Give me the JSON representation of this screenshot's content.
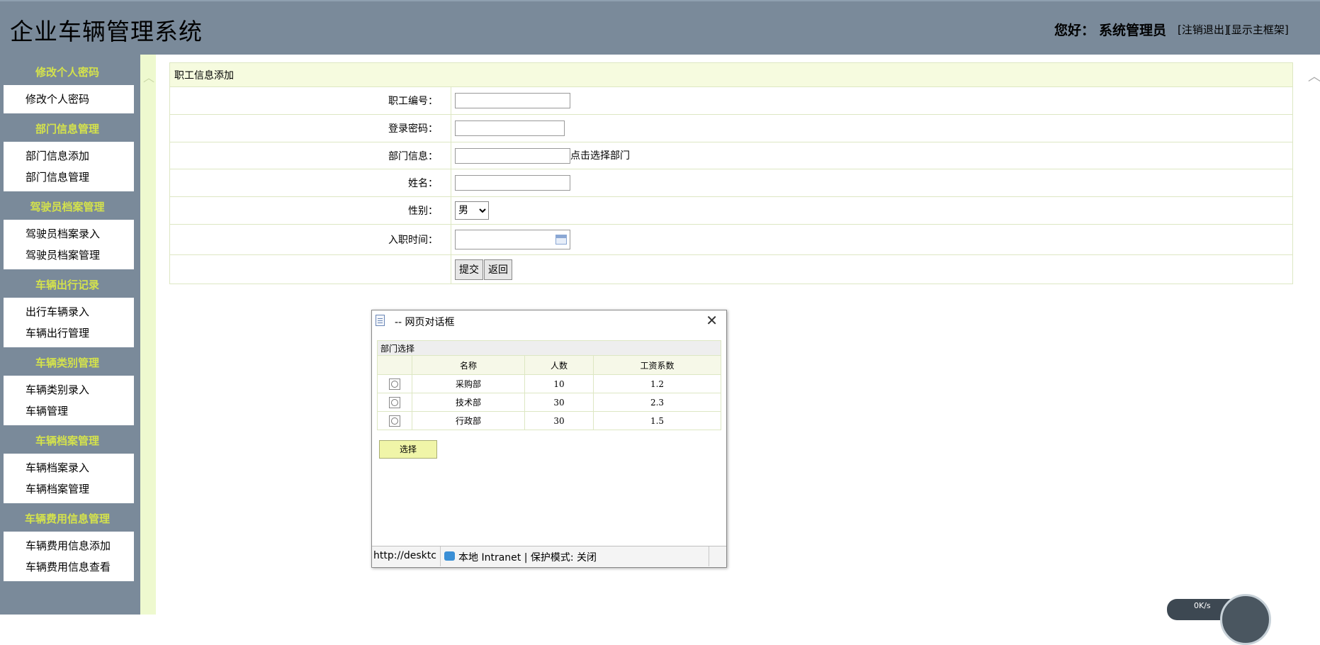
{
  "header": {
    "title": "企业车辆管理系统",
    "greeting_prefix": "您好：",
    "user_name": "系统管理员",
    "logout_label": "[注销退出]",
    "show_frame_label": "[显示主框架]"
  },
  "sidebar": {
    "groups": [
      {
        "title": "修改个人密码",
        "items": [
          "修改个人密码"
        ]
      },
      {
        "title": "部门信息管理",
        "items": [
          "部门信息添加",
          "部门信息管理"
        ]
      },
      {
        "title": "驾驶员档案管理",
        "items": [
          "驾驶员档案录入",
          "驾驶员档案管理"
        ]
      },
      {
        "title": "车辆出行记录",
        "items": [
          "出行车辆录入",
          "车辆出行管理"
        ]
      },
      {
        "title": "车辆类别管理",
        "items": [
          "车辆类别录入",
          "车辆管理"
        ]
      },
      {
        "title": "车辆档案管理",
        "items": [
          "车辆档案录入",
          "车辆档案管理"
        ]
      },
      {
        "title": "车辆费用信息管理",
        "items": [
          "车辆费用信息添加",
          "车辆费用信息查看"
        ]
      }
    ]
  },
  "form": {
    "title": "职工信息添加",
    "fields": {
      "employee_no": {
        "label": "职工编号：",
        "value": ""
      },
      "password": {
        "label": "登录密码：",
        "value": ""
      },
      "department": {
        "label": "部门信息：",
        "value": "",
        "hint": "点击选择部门"
      },
      "name": {
        "label": "姓名：",
        "value": ""
      },
      "gender": {
        "label": "性别：",
        "selected": "男"
      },
      "hire_date": {
        "label": "入职时间：",
        "value": ""
      }
    },
    "submit_label": "提交",
    "back_label": "返回"
  },
  "dialog": {
    "title": "-- 网页对话框",
    "caption": "部门选择",
    "columns": [
      "",
      "名称",
      "人数",
      "工资系数"
    ],
    "rows": [
      {
        "name": "采购部",
        "count": "10",
        "coef": "1.2"
      },
      {
        "name": "技术部",
        "count": "30",
        "coef": "2.3"
      },
      {
        "name": "行政部",
        "count": "30",
        "coef": "1.5"
      }
    ],
    "choose_label": "选择",
    "status_url": "http://desktc",
    "status_zone": "本地 Intranet | 保护模式: 关闭"
  },
  "net_widget": {
    "text": "0K/s"
  },
  "icons": {
    "dialog_doc": "page-icon",
    "close": "close-icon",
    "calendar": "calendar-icon",
    "globe": "intranet-icon"
  },
  "colors": {
    "header_bg": "#7a8a9a",
    "sidebar_title": "#d4e24c",
    "form_head_bg": "#f6fbdf",
    "choose_btn": "#f0f5a8"
  }
}
